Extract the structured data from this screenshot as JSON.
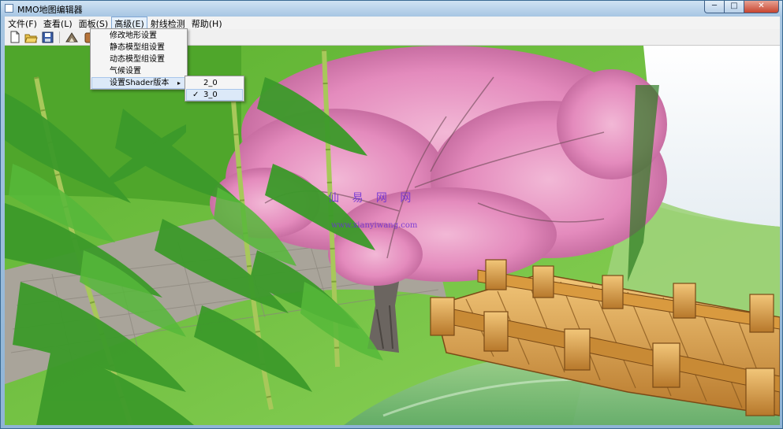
{
  "window": {
    "title": "MMO地图编辑器",
    "minimize_glyph": "─",
    "maximize_glyph": "□",
    "close_glyph": "✕"
  },
  "menubar": {
    "items": [
      {
        "label": "文件(F)"
      },
      {
        "label": "查看(L)"
      },
      {
        "label": "面板(S)"
      },
      {
        "label": "高级(E)"
      },
      {
        "label": "射线检测"
      },
      {
        "label": "帮助(H)"
      }
    ]
  },
  "toolbar": {
    "buttons": [
      "new-file-icon",
      "open-folder-icon",
      "save-disk-icon",
      "terrain-icon",
      "model-icon"
    ]
  },
  "dropdown": {
    "items": [
      {
        "label": "修改地形设置"
      },
      {
        "label": "静态模型组设置"
      },
      {
        "label": "动态模型组设置"
      },
      {
        "label": "气候设置"
      },
      {
        "label": "设置Shader版本",
        "arrow": "▸"
      }
    ]
  },
  "submenu": {
    "items": [
      {
        "label": "2_0"
      },
      {
        "label": "3_0",
        "check": "✓"
      }
    ]
  },
  "watermark": {
    "line1": "仙 易 网 网",
    "line2": "www.xianyiwang.com"
  },
  "colors": {
    "grass": "#7fc54a",
    "blossom": "#e79bc4",
    "wood": "#d99a3f",
    "sky": "#f4f7fb"
  }
}
